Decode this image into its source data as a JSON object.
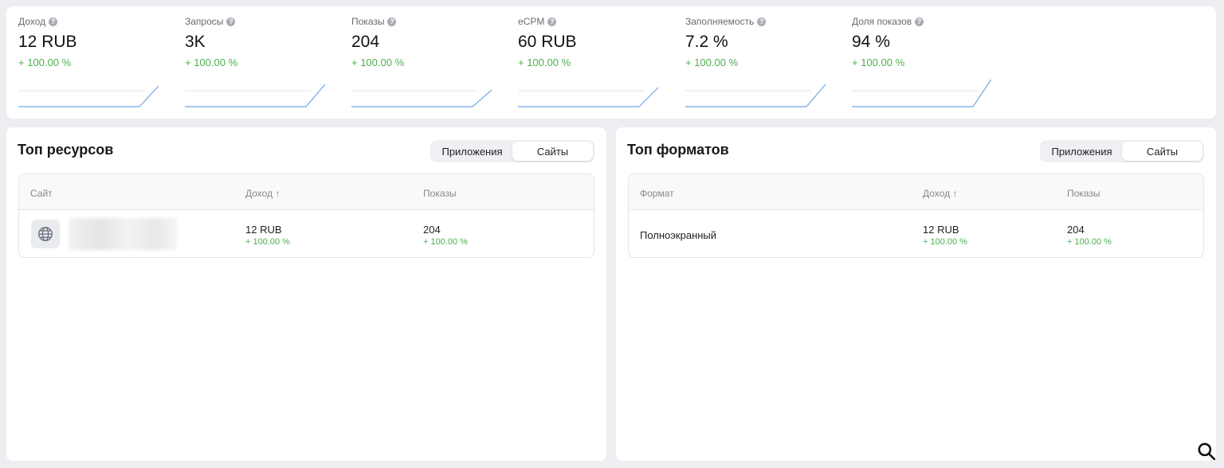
{
  "metrics": [
    {
      "label": "Доход",
      "value": "12 RUB",
      "delta": "+ 100.00 %"
    },
    {
      "label": "Запросы",
      "value": "3K",
      "delta": "+ 100.00 %"
    },
    {
      "label": "Показы",
      "value": "204",
      "delta": "+ 100.00 %"
    },
    {
      "label": "eCPM",
      "value": "60 RUB",
      "delta": "+ 100.00 %"
    },
    {
      "label": "Заполняемость",
      "value": "7.2 %",
      "delta": "+ 100.00 %"
    },
    {
      "label": "Доля показов",
      "value": "94 %",
      "delta": "+ 100.00 %"
    }
  ],
  "help_icon_glyph": "?",
  "top_resources": {
    "title": "Топ ресурсов",
    "tabs": [
      "Приложения",
      "Сайты"
    ],
    "active_tab": "Сайты",
    "columns": [
      "Сайт",
      "Доход ↑",
      "Показы"
    ],
    "rows": [
      {
        "site": "",
        "revenue": "12 RUB",
        "revenue_delta": "+ 100.00 %",
        "impressions": "204",
        "impressions_delta": "+ 100.00 %"
      }
    ]
  },
  "top_formats": {
    "title": "Топ форматов",
    "tabs": [
      "Приложения",
      "Сайты"
    ],
    "active_tab": "Сайты",
    "columns": [
      "Формат",
      "Доход ↑",
      "Показы"
    ],
    "rows": [
      {
        "format": "Полноэкранный",
        "revenue": "12 RUB",
        "revenue_delta": "+ 100.00 %",
        "impressions": "204",
        "impressions_delta": "+ 100.00 %"
      }
    ]
  },
  "colors": {
    "positive": "#4caf50",
    "sparkline": "#6fa8e6",
    "background": "#eceef2"
  },
  "icons": {
    "site": "globe-icon",
    "search": "search-icon",
    "help": "help-circle-icon"
  }
}
